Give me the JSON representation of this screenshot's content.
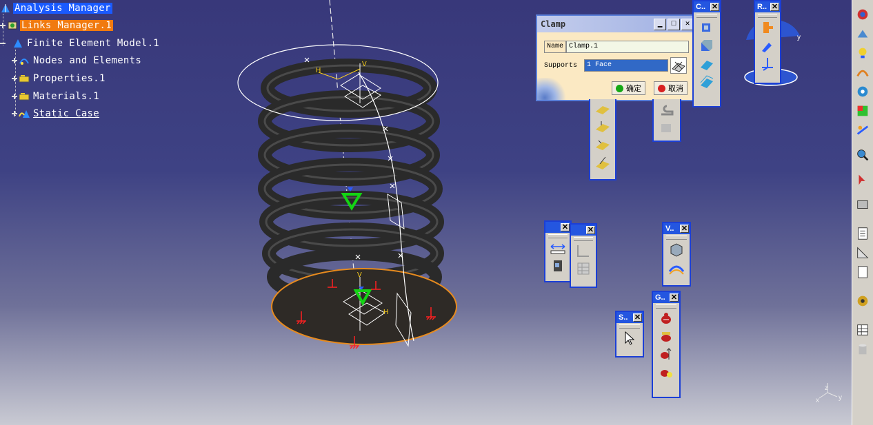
{
  "tree": {
    "items": [
      {
        "label": "Analysis Manager",
        "icon": "analysis-icon",
        "state": "selected"
      },
      {
        "label": "Links Manager.1",
        "icon": "links-icon",
        "state": "highlighted"
      },
      {
        "label": "Finite Element Model.1",
        "icon": "fem-icon",
        "state": "normal"
      },
      {
        "label": "Nodes and Elements",
        "icon": "mesh-icon",
        "state": "normal"
      },
      {
        "label": "Properties.1",
        "icon": "properties-icon",
        "state": "normal"
      },
      {
        "label": "Materials.1",
        "icon": "materials-icon",
        "state": "normal"
      },
      {
        "label": "Static Case",
        "icon": "static-case-icon",
        "state": "underlined"
      }
    ]
  },
  "dialog": {
    "title": "Clamp",
    "name_label": "Name",
    "name_value": "Clamp.1",
    "supports_label": "Supports",
    "supports_value": "1 Face",
    "ok_label": "确定",
    "cancel_label": "取消"
  },
  "toolbars": {
    "c_title": "C..",
    "r_title": "R..",
    "v_title": "V..",
    "s_title": "S..",
    "g_title": "G.."
  },
  "viewport": {
    "spring_labels": {
      "h1": "H",
      "v1": "V",
      "h2": "H",
      "v2": "V"
    },
    "axis": {
      "x": "x",
      "y": "y",
      "z": "z"
    },
    "compass_y": "y"
  }
}
